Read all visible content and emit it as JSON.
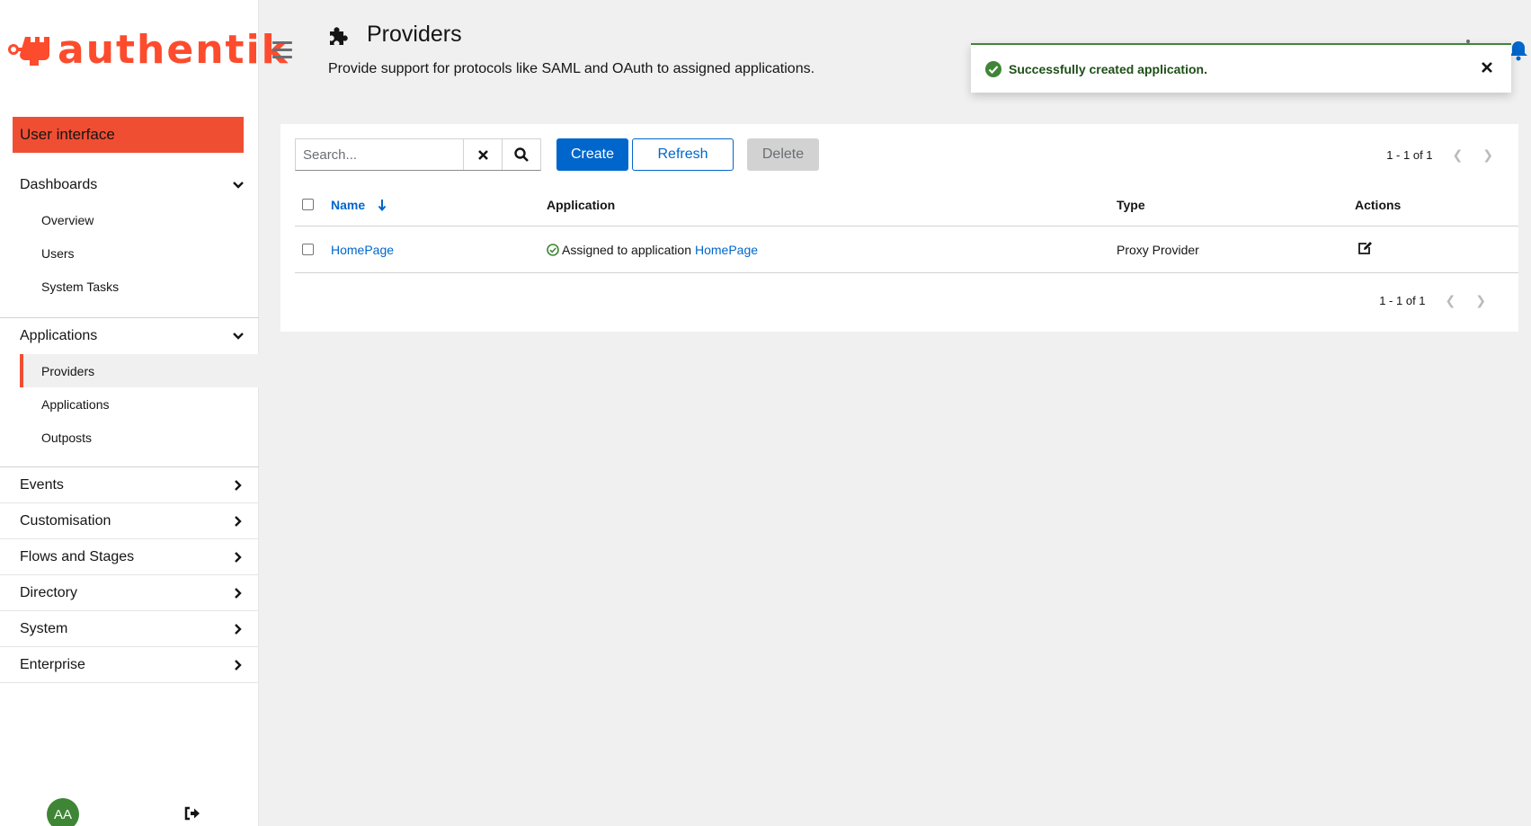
{
  "brand": {
    "name": "authentik"
  },
  "sidebar": {
    "user_interface_label": "User interface",
    "sections": [
      {
        "label": "Dashboards",
        "expanded": true,
        "items": [
          "Overview",
          "Users",
          "System Tasks"
        ]
      },
      {
        "label": "Applications",
        "expanded": true,
        "items": [
          "Providers",
          "Applications",
          "Outposts"
        ],
        "active_item": "Providers"
      }
    ],
    "collapsed": [
      "Events",
      "Customisation",
      "Flows and Stages",
      "Directory",
      "System",
      "Enterprise"
    ],
    "avatar_initials": "AA"
  },
  "header": {
    "title": "Providers",
    "description": "Provide support for protocols like SAML and OAuth to assigned applications."
  },
  "toast": {
    "message": "Successfully created application."
  },
  "toolbar": {
    "search_placeholder": "Search...",
    "create_label": "Create",
    "refresh_label": "Refresh",
    "delete_label": "Delete",
    "pagination": "1 - 1 of 1"
  },
  "table": {
    "columns": [
      "Name",
      "Application",
      "Type",
      "Actions"
    ],
    "rows": [
      {
        "name": "HomePage",
        "application_prefix": "Assigned to application",
        "application_link": "HomePage",
        "type": "Proxy Provider"
      }
    ],
    "pagination_bottom": "1 - 1 of 1"
  },
  "colors": {
    "brand": "#fd4b2d",
    "accent": "#f04e33",
    "primary": "#0066cc",
    "success": "#3e8635"
  }
}
